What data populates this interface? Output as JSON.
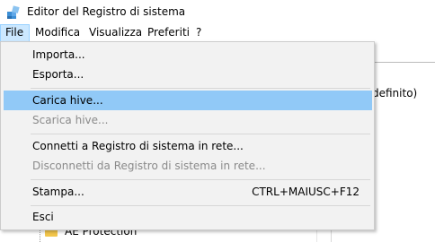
{
  "window": {
    "title": "Editor del Registro di sistema"
  },
  "menubar": [
    {
      "label": "File",
      "active": true
    },
    {
      "label": "Modifica"
    },
    {
      "label": "Visualizza"
    },
    {
      "label": "Preferiti"
    },
    {
      "label": "?"
    }
  ],
  "file_menu": {
    "items": [
      {
        "label": "Importa...",
        "enabled": true
      },
      {
        "label": "Esporta...",
        "enabled": true
      },
      {
        "label": "Carica hive...",
        "enabled": true,
        "highlighted": true
      },
      {
        "label": "Scarica hive...",
        "enabled": false
      },
      {
        "label": "Connetti a Registro di sistema in rete...",
        "enabled": true
      },
      {
        "label": "Disconnetti da Registro di sistema in rete...",
        "enabled": false
      },
      {
        "label": "Stampa...",
        "enabled": true,
        "shortcut": "CTRL+MAIUSC+F12"
      },
      {
        "label": "Esci",
        "enabled": true
      }
    ]
  },
  "background": {
    "value_fragment": "definito)",
    "tree_item": "AE Protection"
  },
  "colors": {
    "highlight": "#91c9f7",
    "menu_active": "#cce8ff",
    "disabled_text": "#8a8a8a"
  }
}
